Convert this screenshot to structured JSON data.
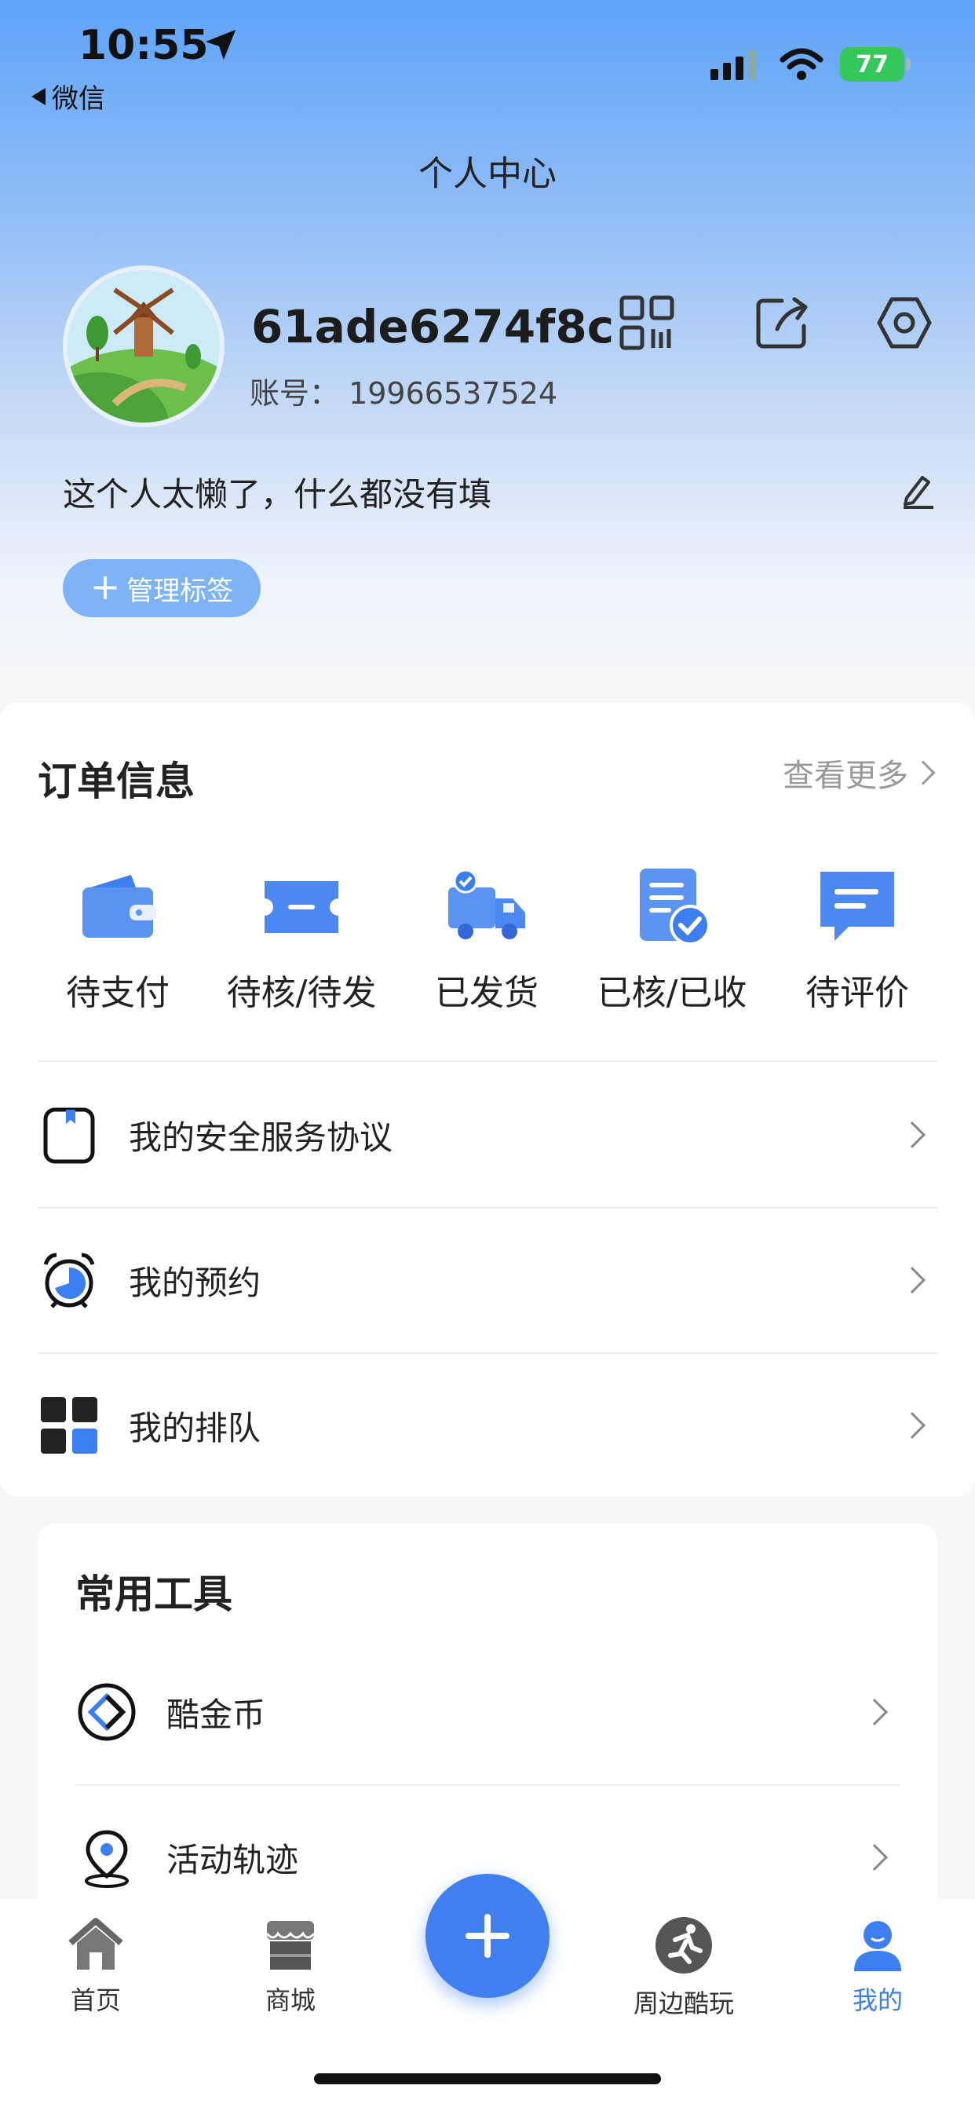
{
  "status_bar": {
    "time": "10:55",
    "back_label": "微信",
    "battery": "77"
  },
  "header": {
    "title": "个人中心"
  },
  "profile": {
    "username": "61ade6274f8c",
    "account": "账号： 19966537524",
    "bio": "这个人太懒了，什么都没有填",
    "tag_button": "管理标签",
    "icons": [
      "qr-code-icon",
      "share-icon",
      "settings-icon",
      "edit-icon"
    ]
  },
  "orders": {
    "title": "订单信息",
    "see_more": "查看更多",
    "items": [
      {
        "label": "待支付",
        "icon": "wallet-icon"
      },
      {
        "label": "待核/待发",
        "icon": "ticket-icon"
      },
      {
        "label": "已发货",
        "icon": "truck-icon"
      },
      {
        "label": "已核/已收",
        "icon": "checked-document-icon"
      },
      {
        "label": "待评价",
        "icon": "comment-icon"
      }
    ],
    "rows": [
      {
        "label": "我的安全服务协议",
        "icon": "agreement-icon"
      },
      {
        "label": "我的预约",
        "icon": "alarm-clock-icon"
      },
      {
        "label": "我的排队",
        "icon": "queue-grid-icon"
      }
    ]
  },
  "tools": {
    "title": "常用工具",
    "rows": [
      {
        "label": "酷金币",
        "icon": "coin-icon"
      },
      {
        "label": "活动轨迹",
        "icon": "location-icon"
      }
    ]
  },
  "tabbar": {
    "tabs": [
      {
        "label": "首页",
        "icon": "home-icon"
      },
      {
        "label": "商城",
        "icon": "store-icon"
      },
      {
        "label": "周边酷玩",
        "icon": "runner-icon"
      },
      {
        "label": "我的",
        "icon": "person-icon",
        "active": true
      }
    ],
    "fab_icon": "plus-icon"
  },
  "colors": {
    "accent": "#3d7ef0",
    "tag_bg": "#7db2f5",
    "battery": "#35c759"
  }
}
